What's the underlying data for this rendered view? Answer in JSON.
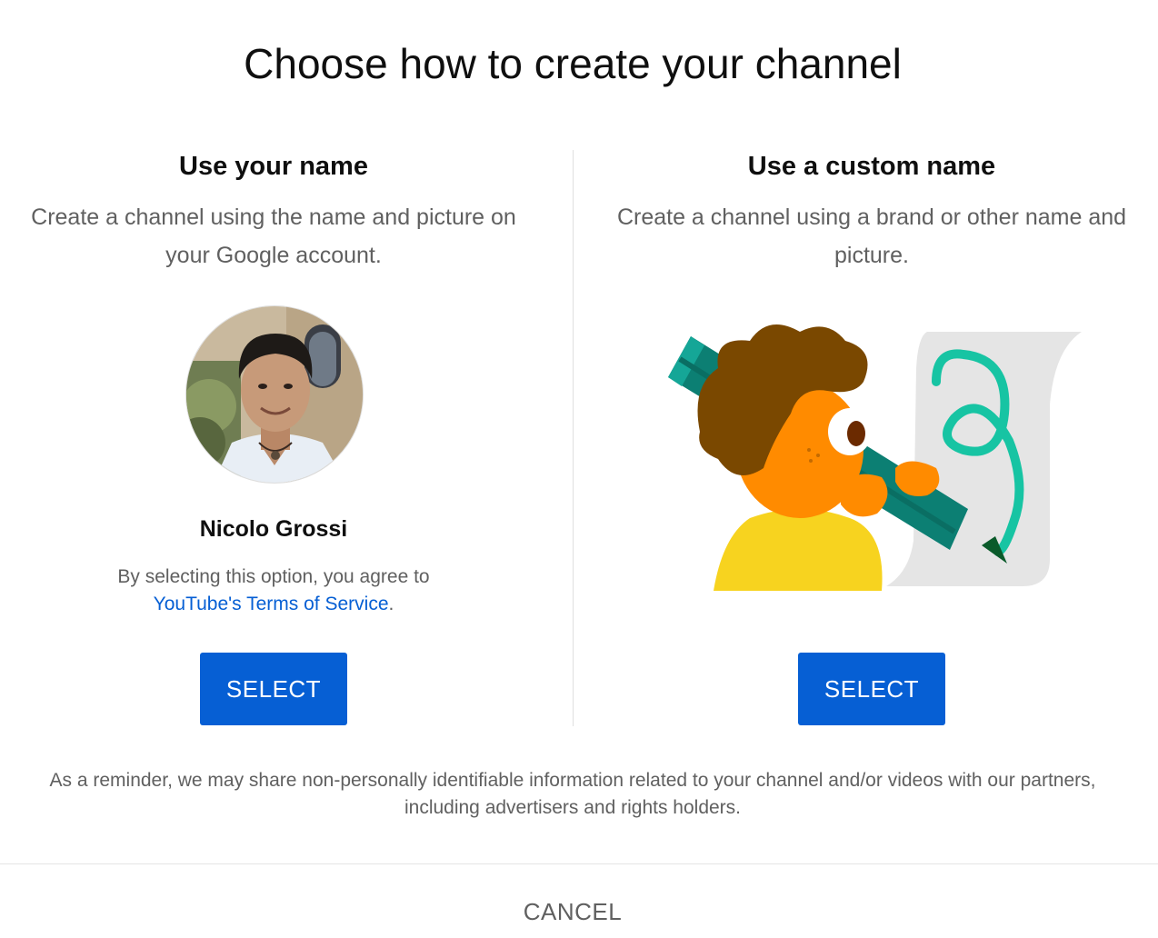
{
  "page_title": "Choose how to create your channel",
  "option_own_name": {
    "title": "Use your name",
    "description": "Create a channel using the name and picture on your Google account.",
    "user_name": "Nicolo Grossi",
    "agreement_prefix": "By selecting this option, you agree to",
    "tos_link": "YouTube's Terms of Service",
    "agreement_suffix": ".",
    "select_label": "SELECT"
  },
  "option_custom_name": {
    "title": "Use a custom name",
    "description": "Create a channel using a brand or other name and picture.",
    "select_label": "SELECT"
  },
  "reminder": "As a reminder, we may share non-personally identifiable information related to your channel and/or videos with our partners, including advertisers and rights holders.",
  "cancel_label": "CANCEL",
  "colors": {
    "primary_button": "#065fd4",
    "link": "#065fd4",
    "secondary_text": "#606060"
  }
}
